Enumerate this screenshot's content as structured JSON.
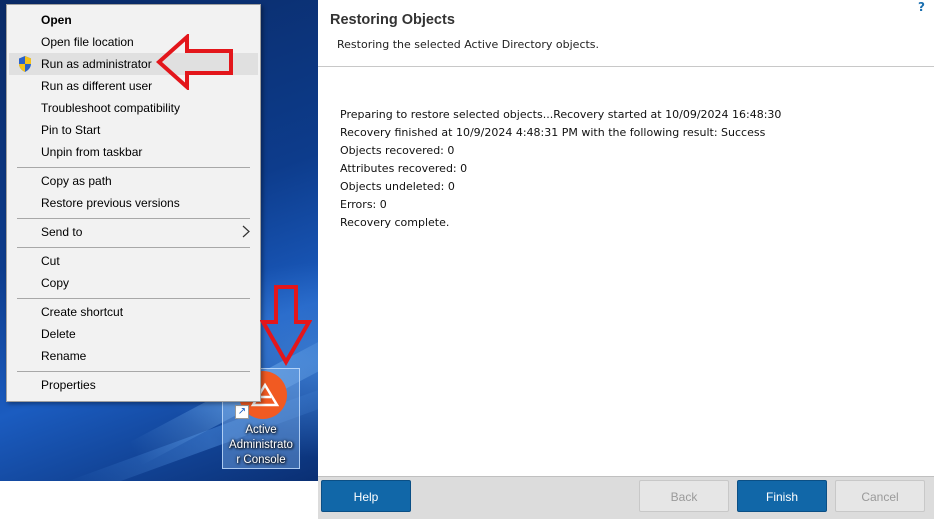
{
  "context_menu": {
    "items": [
      {
        "label": "Open"
      },
      {
        "label": "Open file location"
      },
      {
        "label": "Run as administrator"
      },
      {
        "label": "Run as different user"
      },
      {
        "label": "Troubleshoot compatibility"
      },
      {
        "label": "Pin to Start"
      },
      {
        "label": "Unpin from taskbar"
      },
      {
        "label": "Copy as path"
      },
      {
        "label": "Restore previous versions"
      },
      {
        "label": "Send to"
      },
      {
        "label": "Cut"
      },
      {
        "label": "Copy"
      },
      {
        "label": "Create shortcut"
      },
      {
        "label": "Delete"
      },
      {
        "label": "Rename"
      },
      {
        "label": "Properties"
      }
    ],
    "highlighted": "Run as administrator",
    "icons": {
      "run_as_admin": "uac-shield-icon",
      "send_to": "chevron-right-icon"
    }
  },
  "desktop": {
    "icon_caption": "Active Administrator Console",
    "icon_caption_lines": [
      "Active",
      "Administrato",
      "r Console"
    ],
    "annotation_color": "#e3161b"
  },
  "wizard": {
    "title": "Restoring Objects",
    "subtitle": "Restoring the selected Active Directory objects.",
    "help_link": "?",
    "log_lines": [
      "Preparing to restore selected objects...Recovery started at 10/09/2024 16:48:30",
      "Recovery finished at 10/9/2024 4:48:31 PM with the following result: Success",
      "Objects recovered: 0",
      "Attributes recovered: 0",
      "Objects undeleted: 0",
      "Errors: 0",
      "Recovery complete."
    ],
    "buttons": {
      "help": "Help",
      "back": "Back",
      "finish": "Finish",
      "cancel": "Cancel"
    },
    "accent_color": "#1167a8"
  }
}
